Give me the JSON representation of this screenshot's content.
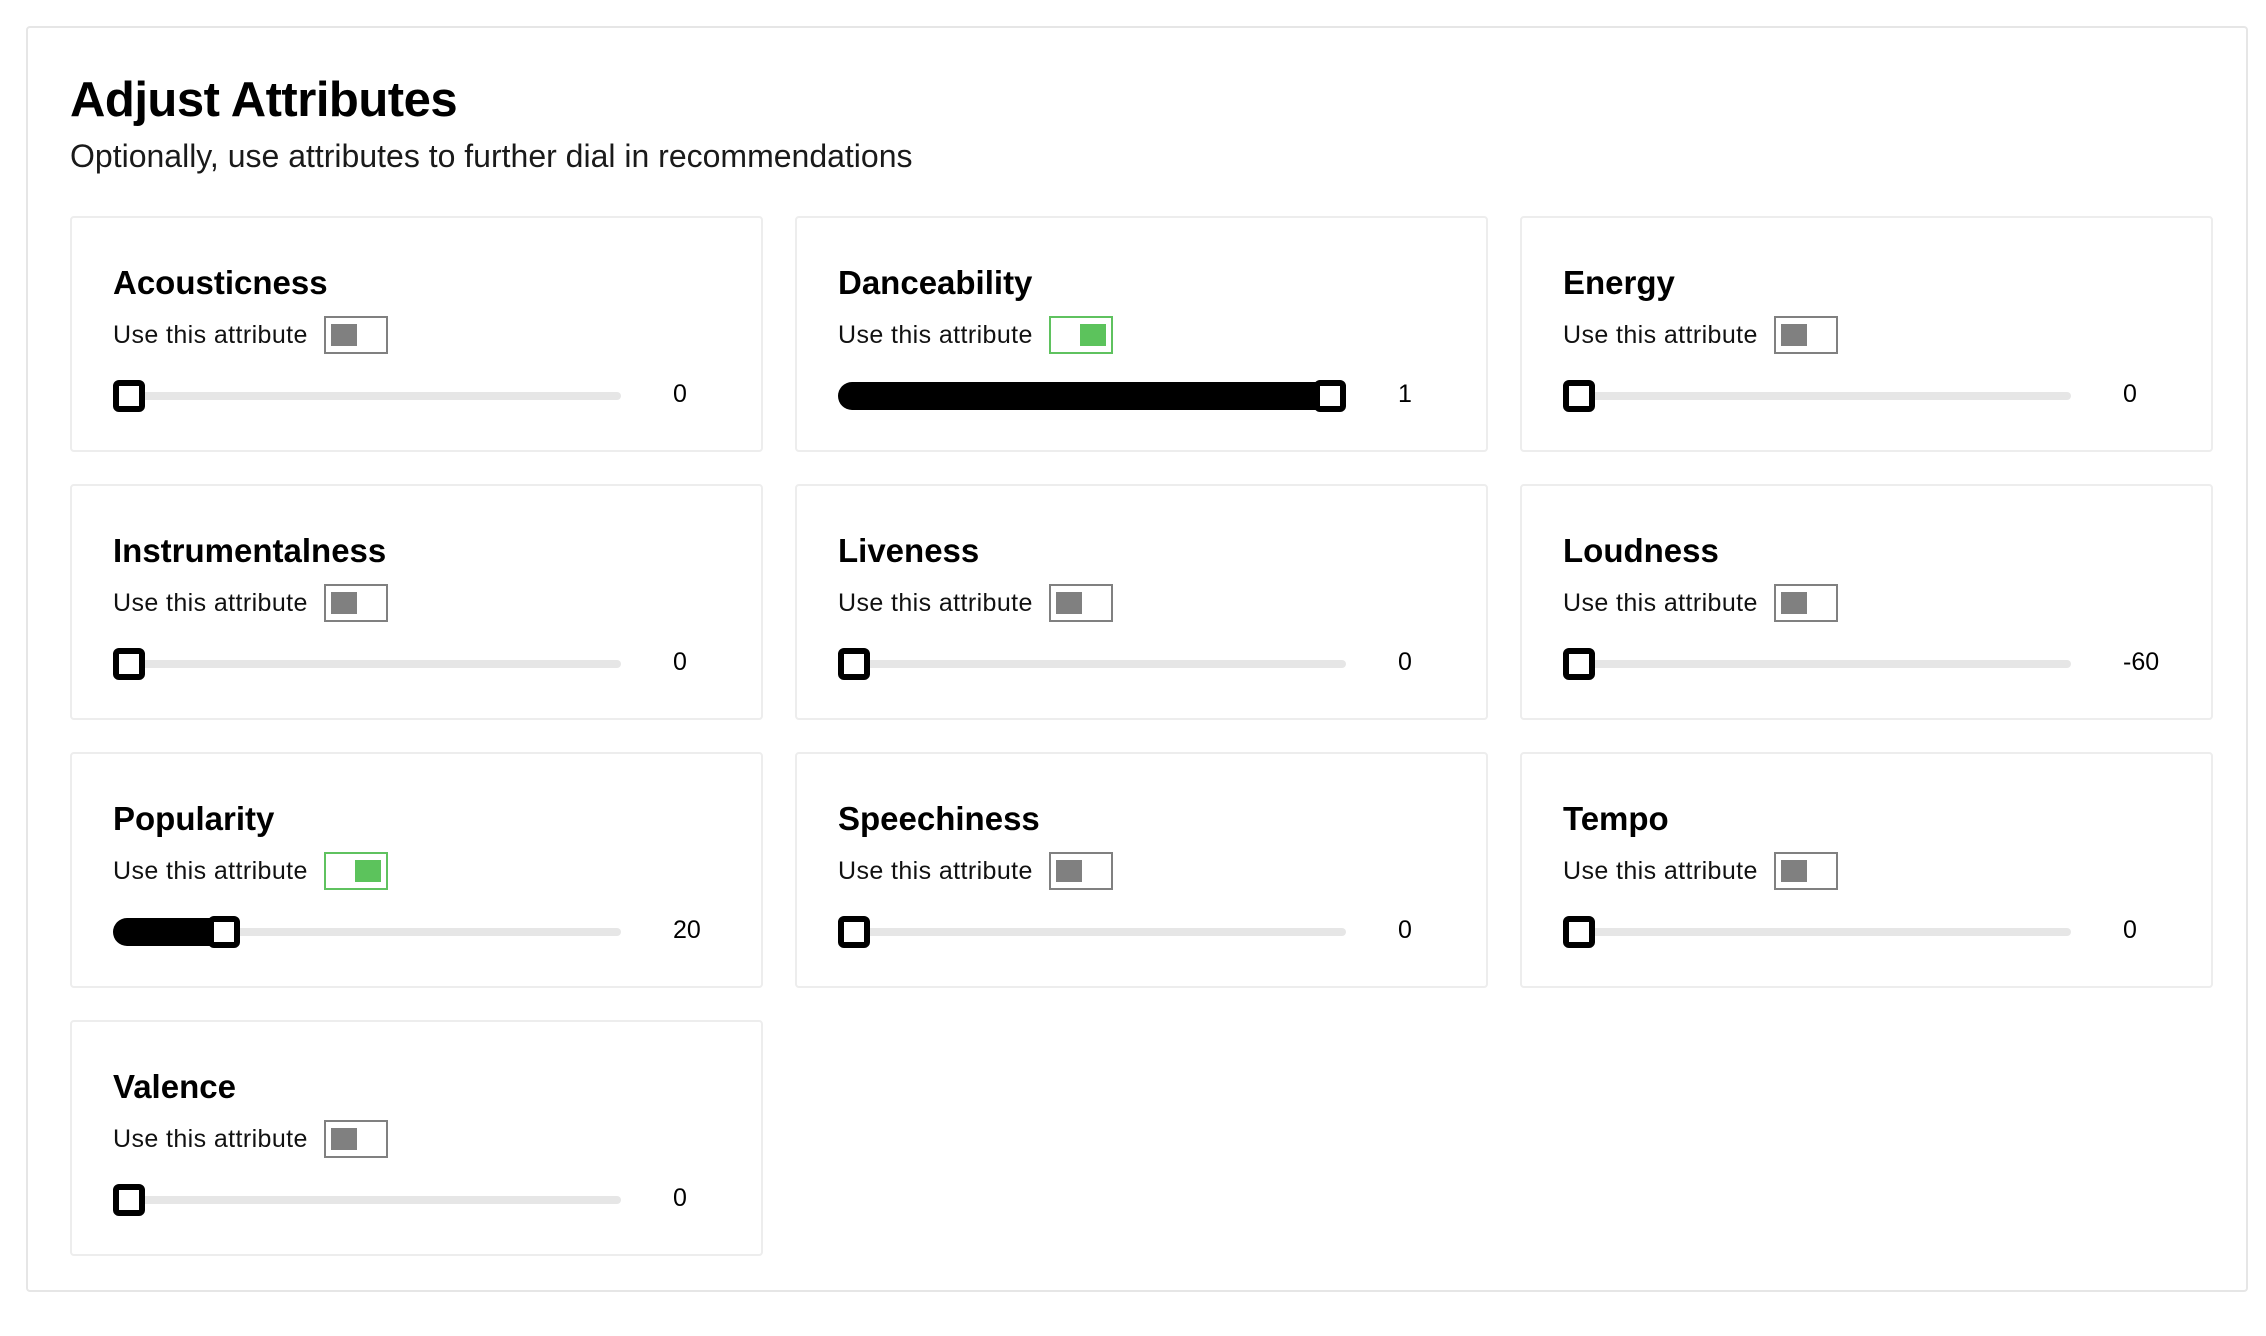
{
  "header": {
    "title": "Adjust Attributes",
    "subtitle": "Optionally, use attributes to further dial in recommendations"
  },
  "toggle_label": "Use this attribute",
  "colors": {
    "toggle_on": "#5cc35c",
    "toggle_off": "#808080",
    "slider_fill": "#000000",
    "slider_track": "#e6e6e6"
  },
  "attributes": [
    {
      "name": "Acousticness",
      "enabled": false,
      "value": "0",
      "level": 0
    },
    {
      "name": "Danceability",
      "enabled": true,
      "value": "1",
      "level": 1
    },
    {
      "name": "Energy",
      "enabled": false,
      "value": "0",
      "level": 0
    },
    {
      "name": "Instrumentalness",
      "enabled": false,
      "value": "0",
      "level": 0
    },
    {
      "name": "Liveness",
      "enabled": false,
      "value": "0",
      "level": 0
    },
    {
      "name": "Loudness",
      "enabled": false,
      "value": "-60",
      "level": 0
    },
    {
      "name": "Popularity",
      "enabled": true,
      "value": "20",
      "level": 0.2
    },
    {
      "name": "Speechiness",
      "enabled": false,
      "value": "0",
      "level": 0
    },
    {
      "name": "Tempo",
      "enabled": false,
      "value": "0",
      "level": 0
    },
    {
      "name": "Valence",
      "enabled": false,
      "value": "0",
      "level": 0
    }
  ]
}
